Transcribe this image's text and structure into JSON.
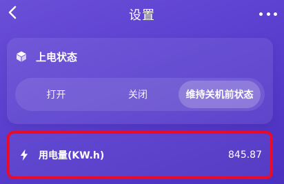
{
  "header": {
    "title": "设置",
    "back_icon": "chevron-left-icon",
    "more_icon": "more-horizontal-icon"
  },
  "power_state_card": {
    "icon": "cube-icon",
    "title": "上电状态",
    "options": [
      {
        "label": "打开",
        "selected": false
      },
      {
        "label": "关闭",
        "selected": false
      },
      {
        "label": "维持关机前状态",
        "selected": true
      }
    ]
  },
  "energy_card": {
    "icon": "lightning-icon",
    "label": "用电量(KW.h)",
    "value": "845.87",
    "highlight_color": "#ea0b2a"
  },
  "colors": {
    "bg_top": "#6a4fd8",
    "bg_bottom": "#4b2fc0",
    "text": "#ffffff"
  }
}
